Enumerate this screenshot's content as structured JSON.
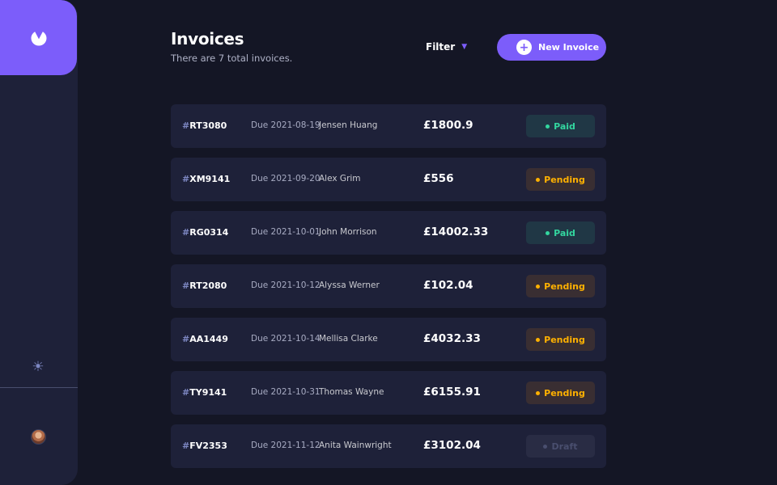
{
  "header": {
    "title": "Invoices",
    "subtitle": "There are 7 total invoices.",
    "filter_label": "Filter",
    "new_invoice_label": "New Invoice"
  },
  "colors": {
    "accent": "#7c5dfa",
    "background": "#141625",
    "card": "#1e2139",
    "paid": "#33d69f",
    "pending": "#ffb100",
    "draft": "#494e6e"
  },
  "icons": {
    "logo": "logo-icon",
    "theme": "sun-icon",
    "filter": "chevron-down-icon",
    "new": "plus-icon"
  },
  "invoices": [
    {
      "hash": "#",
      "id": "RT3080",
      "due": "Due 2021-08-19",
      "client": "Jensen Huang",
      "amount": "£1800.9",
      "status": "Paid",
      "status_key": "paid"
    },
    {
      "hash": "#",
      "id": "XM9141",
      "due": "Due 2021-09-20",
      "client": "Alex Grim",
      "amount": "£556",
      "status": "Pending",
      "status_key": "pending"
    },
    {
      "hash": "#",
      "id": "RG0314",
      "due": "Due 2021-10-01",
      "client": "John Morrison",
      "amount": "£14002.33",
      "status": "Paid",
      "status_key": "paid"
    },
    {
      "hash": "#",
      "id": "RT2080",
      "due": "Due 2021-10-12",
      "client": "Alyssa Werner",
      "amount": "£102.04",
      "status": "Pending",
      "status_key": "pending"
    },
    {
      "hash": "#",
      "id": "AA1449",
      "due": "Due 2021-10-14",
      "client": "Mellisa Clarke",
      "amount": "£4032.33",
      "status": "Pending",
      "status_key": "pending"
    },
    {
      "hash": "#",
      "id": "TY9141",
      "due": "Due 2021-10-31",
      "client": "Thomas Wayne",
      "amount": "£6155.91",
      "status": "Pending",
      "status_key": "pending"
    },
    {
      "hash": "#",
      "id": "FV2353",
      "due": "Due 2021-11-12",
      "client": "Anita Wainwright",
      "amount": "£3102.04",
      "status": "Draft",
      "status_key": "draft"
    }
  ]
}
